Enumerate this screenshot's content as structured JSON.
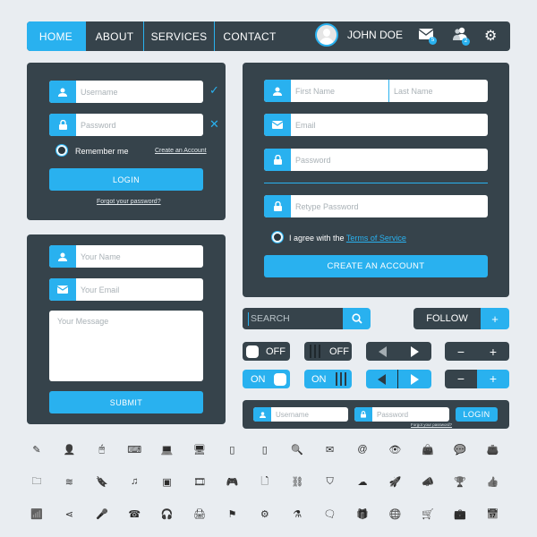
{
  "nav": {
    "tabs": [
      {
        "label": "HOME",
        "active": true
      },
      {
        "label": "ABOUT",
        "active": false
      },
      {
        "label": "SERVICES",
        "active": false
      },
      {
        "label": "CONTACT",
        "active": false
      }
    ],
    "user_name": "JOHN DOE",
    "mail_badge": "5",
    "friends_badge": "2",
    "icons": {
      "mail": "✉",
      "friends": "👥",
      "settings": "⚙"
    }
  },
  "login_panel": {
    "username_placeholder": "Username",
    "password_placeholder": "Password",
    "valid_mark": "✓",
    "invalid_mark": "✕",
    "remember_label": "Remember me",
    "create_account_link": "Create an Account",
    "login_button": "LOGIN",
    "forgot_link": "Forgot your password?"
  },
  "register_panel": {
    "first_name_placeholder": "First Name",
    "last_name_placeholder": "Last Name",
    "email_placeholder": "Email",
    "password_placeholder": "Password",
    "retype_placeholder": "Retype Password",
    "agree_text": "I agree with the ",
    "terms_link": "Terms of Service",
    "create_button": "CREATE AN ACCOUNT"
  },
  "contact_panel": {
    "name_placeholder": "Your Name",
    "email_placeholder": "Your Email",
    "message_placeholder": "Your Message",
    "submit_button": "SUBMIT"
  },
  "controls": {
    "search_placeholder": "SEARCH",
    "follow_label": "FOLLOW",
    "plus": "+",
    "minus": "−",
    "off_label": "OFF",
    "on_label": "ON"
  },
  "inline_login": {
    "username_placeholder": "Username",
    "password_placeholder": "Password",
    "login_button": "LOGIN",
    "forgot_link": "Forgot your password?"
  },
  "icon_set": {
    "rows": [
      [
        "pencil",
        "user",
        "mouse",
        "keyboard",
        "laptop",
        "monitor",
        "tablet",
        "phone",
        "search",
        "mail",
        "at",
        "eye",
        "shopping-bag",
        "chat",
        "wallet"
      ],
      [
        "folder",
        "layers",
        "bookmark",
        "music",
        "image",
        "film",
        "gamepad",
        "file",
        "link",
        "shield",
        "cloud",
        "rocket",
        "megaphone",
        "trophy",
        "thumbs-up"
      ],
      [
        "wifi",
        "share",
        "microphone",
        "telephone",
        "headphones",
        "printer",
        "flag",
        "gear",
        "flask",
        "comments",
        "gift",
        "globe",
        "cart",
        "briefcase",
        "calendar"
      ]
    ],
    "glyphs": [
      [
        "✎",
        "👤",
        "🖱",
        "⌨",
        "💻",
        "🖥",
        "▯",
        "▯",
        "🔍",
        "✉",
        "@",
        "👁",
        "👜",
        "💬",
        "👛"
      ],
      [
        "🗀",
        "≋",
        "🔖",
        "♫",
        "▣",
        "🎞",
        "🎮",
        "🗋",
        "⛓",
        "⛉",
        "☁",
        "🚀",
        "📣",
        "🏆",
        "👍"
      ],
      [
        "📶",
        "⋖",
        "🎤",
        "☎",
        "🎧",
        "🖨",
        "⚑",
        "⚙",
        "⚗",
        "🗨",
        "🎁",
        "🌐",
        "🛒",
        "💼",
        "📅"
      ]
    ]
  }
}
